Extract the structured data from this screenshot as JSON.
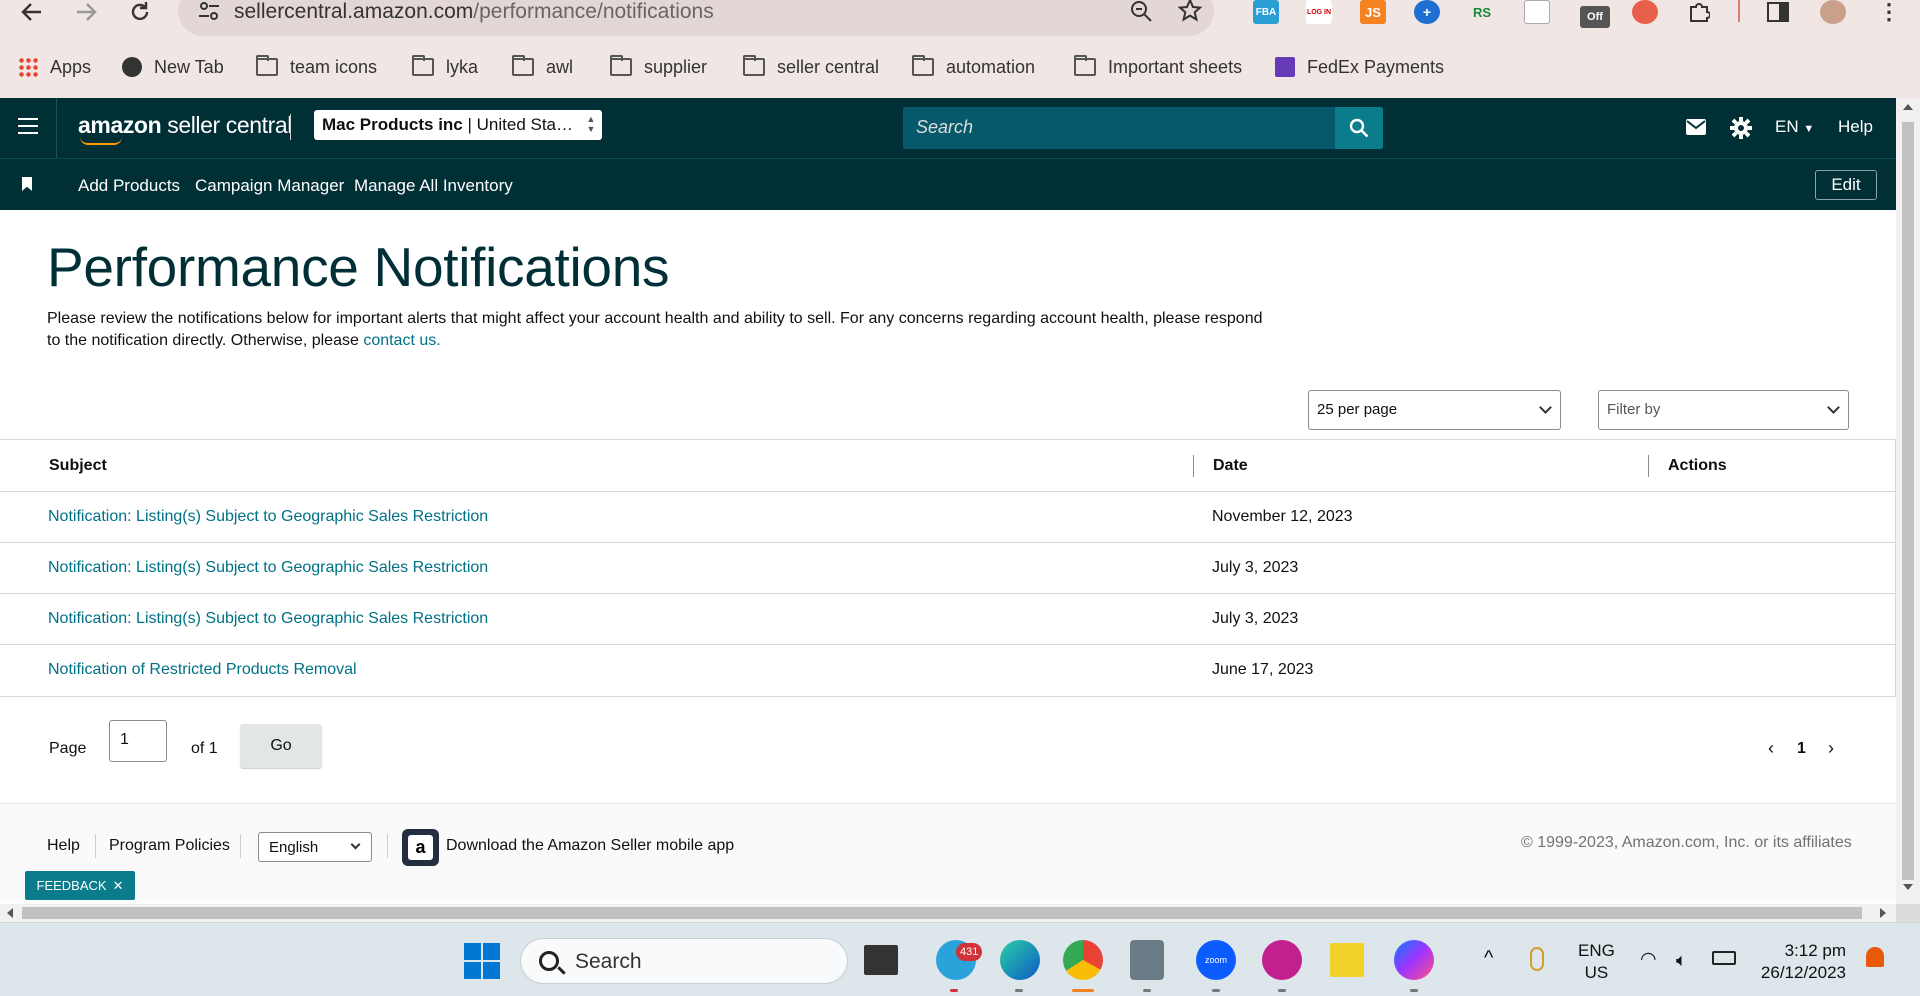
{
  "browser": {
    "url_host": "sellercentral.amazon.com",
    "url_path": "/performance/notifications",
    "bookmarks": [
      "Apps",
      "New Tab",
      "team icons",
      "lyka",
      "awl",
      "supplier",
      "seller central",
      "automation",
      "Important sheets",
      "FedEx Payments"
    ],
    "extensions": [
      "FBA",
      "LOG IN",
      "JS",
      "RS",
      "Off"
    ]
  },
  "header": {
    "logo_bold": "amazon",
    "logo_rest": " seller central",
    "account_name": "Mac Products inc",
    "account_market": " | United Sta…",
    "search_placeholder": "Search",
    "language": "EN",
    "help": "Help"
  },
  "subnav": {
    "links": [
      "Add Products",
      "Campaign Manager",
      "Manage All Inventory"
    ],
    "edit": "Edit"
  },
  "page": {
    "title": "Performance Notifications",
    "intro_text": "Please review the notifications below for important alerts that might affect your account health and ability to sell. For any concerns regarding account health, please respond to the notification directly. Otherwise, please ",
    "intro_link": "contact us.",
    "per_page": "25 per page",
    "filter_placeholder": "Filter by"
  },
  "table": {
    "columns": [
      "Subject",
      "Date",
      "Actions"
    ],
    "rows": [
      {
        "subject": "Notification: Listing(s) Subject to Geographic Sales Restriction",
        "date": "November 12, 2023"
      },
      {
        "subject": "Notification: Listing(s) Subject to Geographic Sales Restriction",
        "date": "July 3, 2023"
      },
      {
        "subject": "Notification: Listing(s) Subject to Geographic Sales Restriction",
        "date": "July 3, 2023"
      },
      {
        "subject": "Notification of Restricted Products Removal",
        "date": "June 17, 2023"
      }
    ]
  },
  "pagination": {
    "page_label": "Page",
    "page_value": "1",
    "of_label": "of 1",
    "go": "Go",
    "current": "1"
  },
  "footer": {
    "help": "Help",
    "program_policies": "Program Policies",
    "language": "English",
    "download_app": "Download the Amazon Seller mobile app",
    "copyright": "© 1999-2023, Amazon.com, Inc. or its affiliates",
    "feedback": "FEEDBACK"
  },
  "taskbar": {
    "search": "Search",
    "telegram_badge": "431",
    "zoom_label": "zoom",
    "lang_line1": "ENG",
    "lang_line2": "US",
    "time": "3:12 pm",
    "date": "26/12/2023"
  },
  "colors": {
    "header_bg": "#002f36",
    "link": "#007185",
    "search_bg": "#05596b",
    "accent": "#0a7c8c"
  }
}
